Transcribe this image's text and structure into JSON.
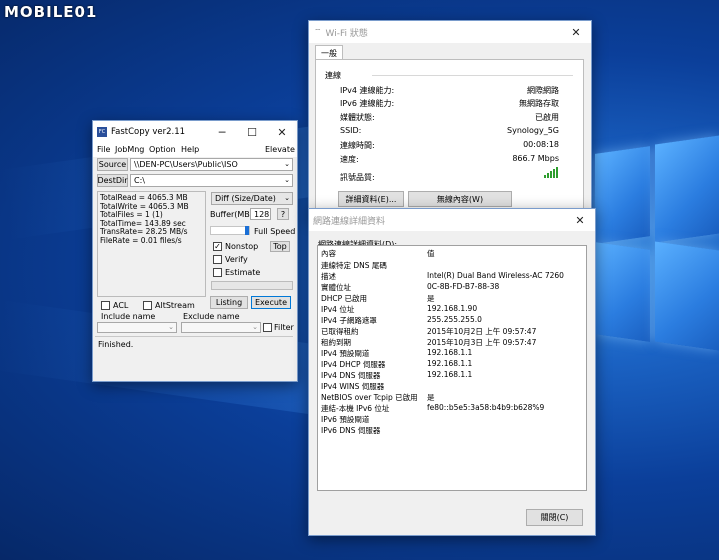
{
  "watermark": {
    "text": "MOBILE01"
  },
  "fastcopy": {
    "title": "FastCopy ver2.11",
    "app_icon_text": "FC",
    "menu": [
      "File",
      "JobMng",
      "Option",
      "Help"
    ],
    "elevate": "Elevate",
    "source_label": "Source",
    "source_value": "\\\\DEN-PC\\Users\\Public\\ISO",
    "destdir_label": "DestDir",
    "destdir_value": "C:\\",
    "stats": [
      "TotalRead = 4065.3 MB",
      "TotalWrite = 4065.3 MB",
      "TotalFiles = 1 (1)",
      "TotalTime= 143.89 sec",
      "TransRate= 28.25 MB/s",
      "FileRate = 0.01 files/s"
    ],
    "mode_value": "Diff (Size/Date)",
    "buffer_label": "Buffer(MB)",
    "buffer_value": "128",
    "help_label": "?",
    "speed_label": "Full Speed",
    "speed_level": 1.0,
    "nonstop_label": "Nonstop",
    "nonstop_checked": true,
    "top_label": "Top",
    "verify_label": "Verify",
    "estimate_label": "Estimate",
    "acl_label": "ACL",
    "altstream_label": "AltStream",
    "listing_label": "Listing",
    "execute_label": "Execute",
    "include_label": "Include name",
    "exclude_label": "Exclude name",
    "filter_label": "Filter",
    "status_text": "Finished.",
    "check_mark": "✓"
  },
  "wifi": {
    "title": "Wi-Fi 狀態",
    "tab": "一般",
    "section": "連線",
    "rows": [
      {
        "k": "IPv4 連線能力:",
        "v": "網際網路"
      },
      {
        "k": "IPv6 連線能力:",
        "v": "無網路存取"
      },
      {
        "k": "媒體狀態:",
        "v": "已啟用"
      },
      {
        "k": "SSID:",
        "v": "Synology_5G"
      },
      {
        "k": "連線時間:",
        "v": "00:08:18"
      },
      {
        "k": "速度:",
        "v": "866.7 Mbps"
      }
    ],
    "signal_label": "訊號品質:",
    "signal_bars": 5,
    "details_button": "詳細資料(E)...",
    "wireless_button": "無線內容(W)"
  },
  "details": {
    "title": "網路連線詳細資料",
    "heading": "網路連線詳細資料(D):",
    "col_property": "內容",
    "col_value": "值",
    "rows": [
      {
        "k": "連線特定 DNS 尾碼",
        "v": ""
      },
      {
        "k": "描述",
        "v": "Intel(R) Dual Band Wireless-AC 7260"
      },
      {
        "k": "實體位址",
        "v": "0C-8B-FD-B7-88-38"
      },
      {
        "k": "DHCP 已啟用",
        "v": "是"
      },
      {
        "k": "IPv4 位址",
        "v": "192.168.1.90"
      },
      {
        "k": "IPv4 子網路遮罩",
        "v": "255.255.255.0"
      },
      {
        "k": "已取得租約",
        "v": "2015年10月2日 上午 09:57:47"
      },
      {
        "k": "租約到期",
        "v": "2015年10月3日 上午 09:57:47"
      },
      {
        "k": "IPv4 預設閘道",
        "v": "192.168.1.1"
      },
      {
        "k": "IPv4 DHCP 伺服器",
        "v": "192.168.1.1"
      },
      {
        "k": "IPv4 DNS 伺服器",
        "v": "192.168.1.1"
      },
      {
        "k": "IPv4 WINS 伺服器",
        "v": ""
      },
      {
        "k": "NetBIOS over Tcpip 已啟用",
        "v": "是"
      },
      {
        "k": "連結-本機 IPv6 位址",
        "v": "fe80::b5e5:3a58:b4b9:b628%9"
      },
      {
        "k": "IPv6 預設閘道",
        "v": ""
      },
      {
        "k": "IPv6 DNS 伺服器",
        "v": ""
      }
    ],
    "close_button": "關閉(C)"
  },
  "icons": [
    "minimize-icon",
    "maximize-icon",
    "close-icon",
    "chevron-down-icon",
    "wifi-icon",
    "signal-bars-icon",
    "network-icon"
  ]
}
